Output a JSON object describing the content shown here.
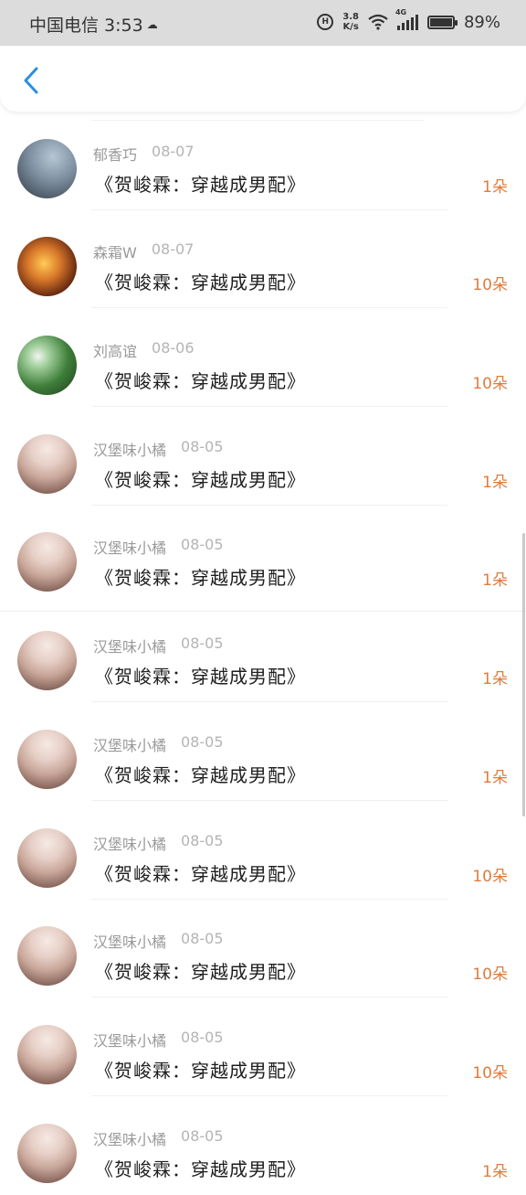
{
  "status_bar": {
    "carrier_time": "中国电信 3:53",
    "speed_value": "3.8",
    "speed_unit": "K/s",
    "network": "4G",
    "battery": "89%"
  },
  "nav": {
    "back_icon": "chevron-left-icon"
  },
  "colors": {
    "accent_blue": "#2a8fe0",
    "amount_orange": "#e07b3c"
  },
  "gifts": [
    {
      "user": "郁香巧",
      "date": "08-07",
      "book": "《贺峻霖：穿越成男配》",
      "amount": "1朵",
      "avatar": "av-sky"
    },
    {
      "user": "森霜W",
      "date": "08-07",
      "book": "《贺峻霖：穿越成男配》",
      "amount": "10朵",
      "avatar": "av-fire"
    },
    {
      "user": "刘高谊",
      "date": "08-06",
      "book": "《贺峻霖：穿越成男配》",
      "amount": "10朵",
      "avatar": "av-green"
    },
    {
      "user": "汉堡味小橘",
      "date": "08-05",
      "book": "《贺峻霖：穿越成男配》",
      "amount": "1朵",
      "avatar": "av-girl"
    },
    {
      "user": "汉堡味小橘",
      "date": "08-05",
      "book": "《贺峻霖：穿越成男配》",
      "amount": "1朵",
      "avatar": "av-girl"
    },
    {
      "user": "汉堡味小橘",
      "date": "08-05",
      "book": "《贺峻霖：穿越成男配》",
      "amount": "1朵",
      "avatar": "av-girl"
    },
    {
      "user": "汉堡味小橘",
      "date": "08-05",
      "book": "《贺峻霖：穿越成男配》",
      "amount": "1朵",
      "avatar": "av-girl"
    },
    {
      "user": "汉堡味小橘",
      "date": "08-05",
      "book": "《贺峻霖：穿越成男配》",
      "amount": "10朵",
      "avatar": "av-girl"
    },
    {
      "user": "汉堡味小橘",
      "date": "08-05",
      "book": "《贺峻霖：穿越成男配》",
      "amount": "10朵",
      "avatar": "av-girl"
    },
    {
      "user": "汉堡味小橘",
      "date": "08-05",
      "book": "《贺峻霖：穿越成男配》",
      "amount": "10朵",
      "avatar": "av-girl"
    },
    {
      "user": "汉堡味小橘",
      "date": "08-05",
      "book": "《贺峻霖：穿越成男配》",
      "amount": "1朵",
      "avatar": "av-girl"
    }
  ]
}
